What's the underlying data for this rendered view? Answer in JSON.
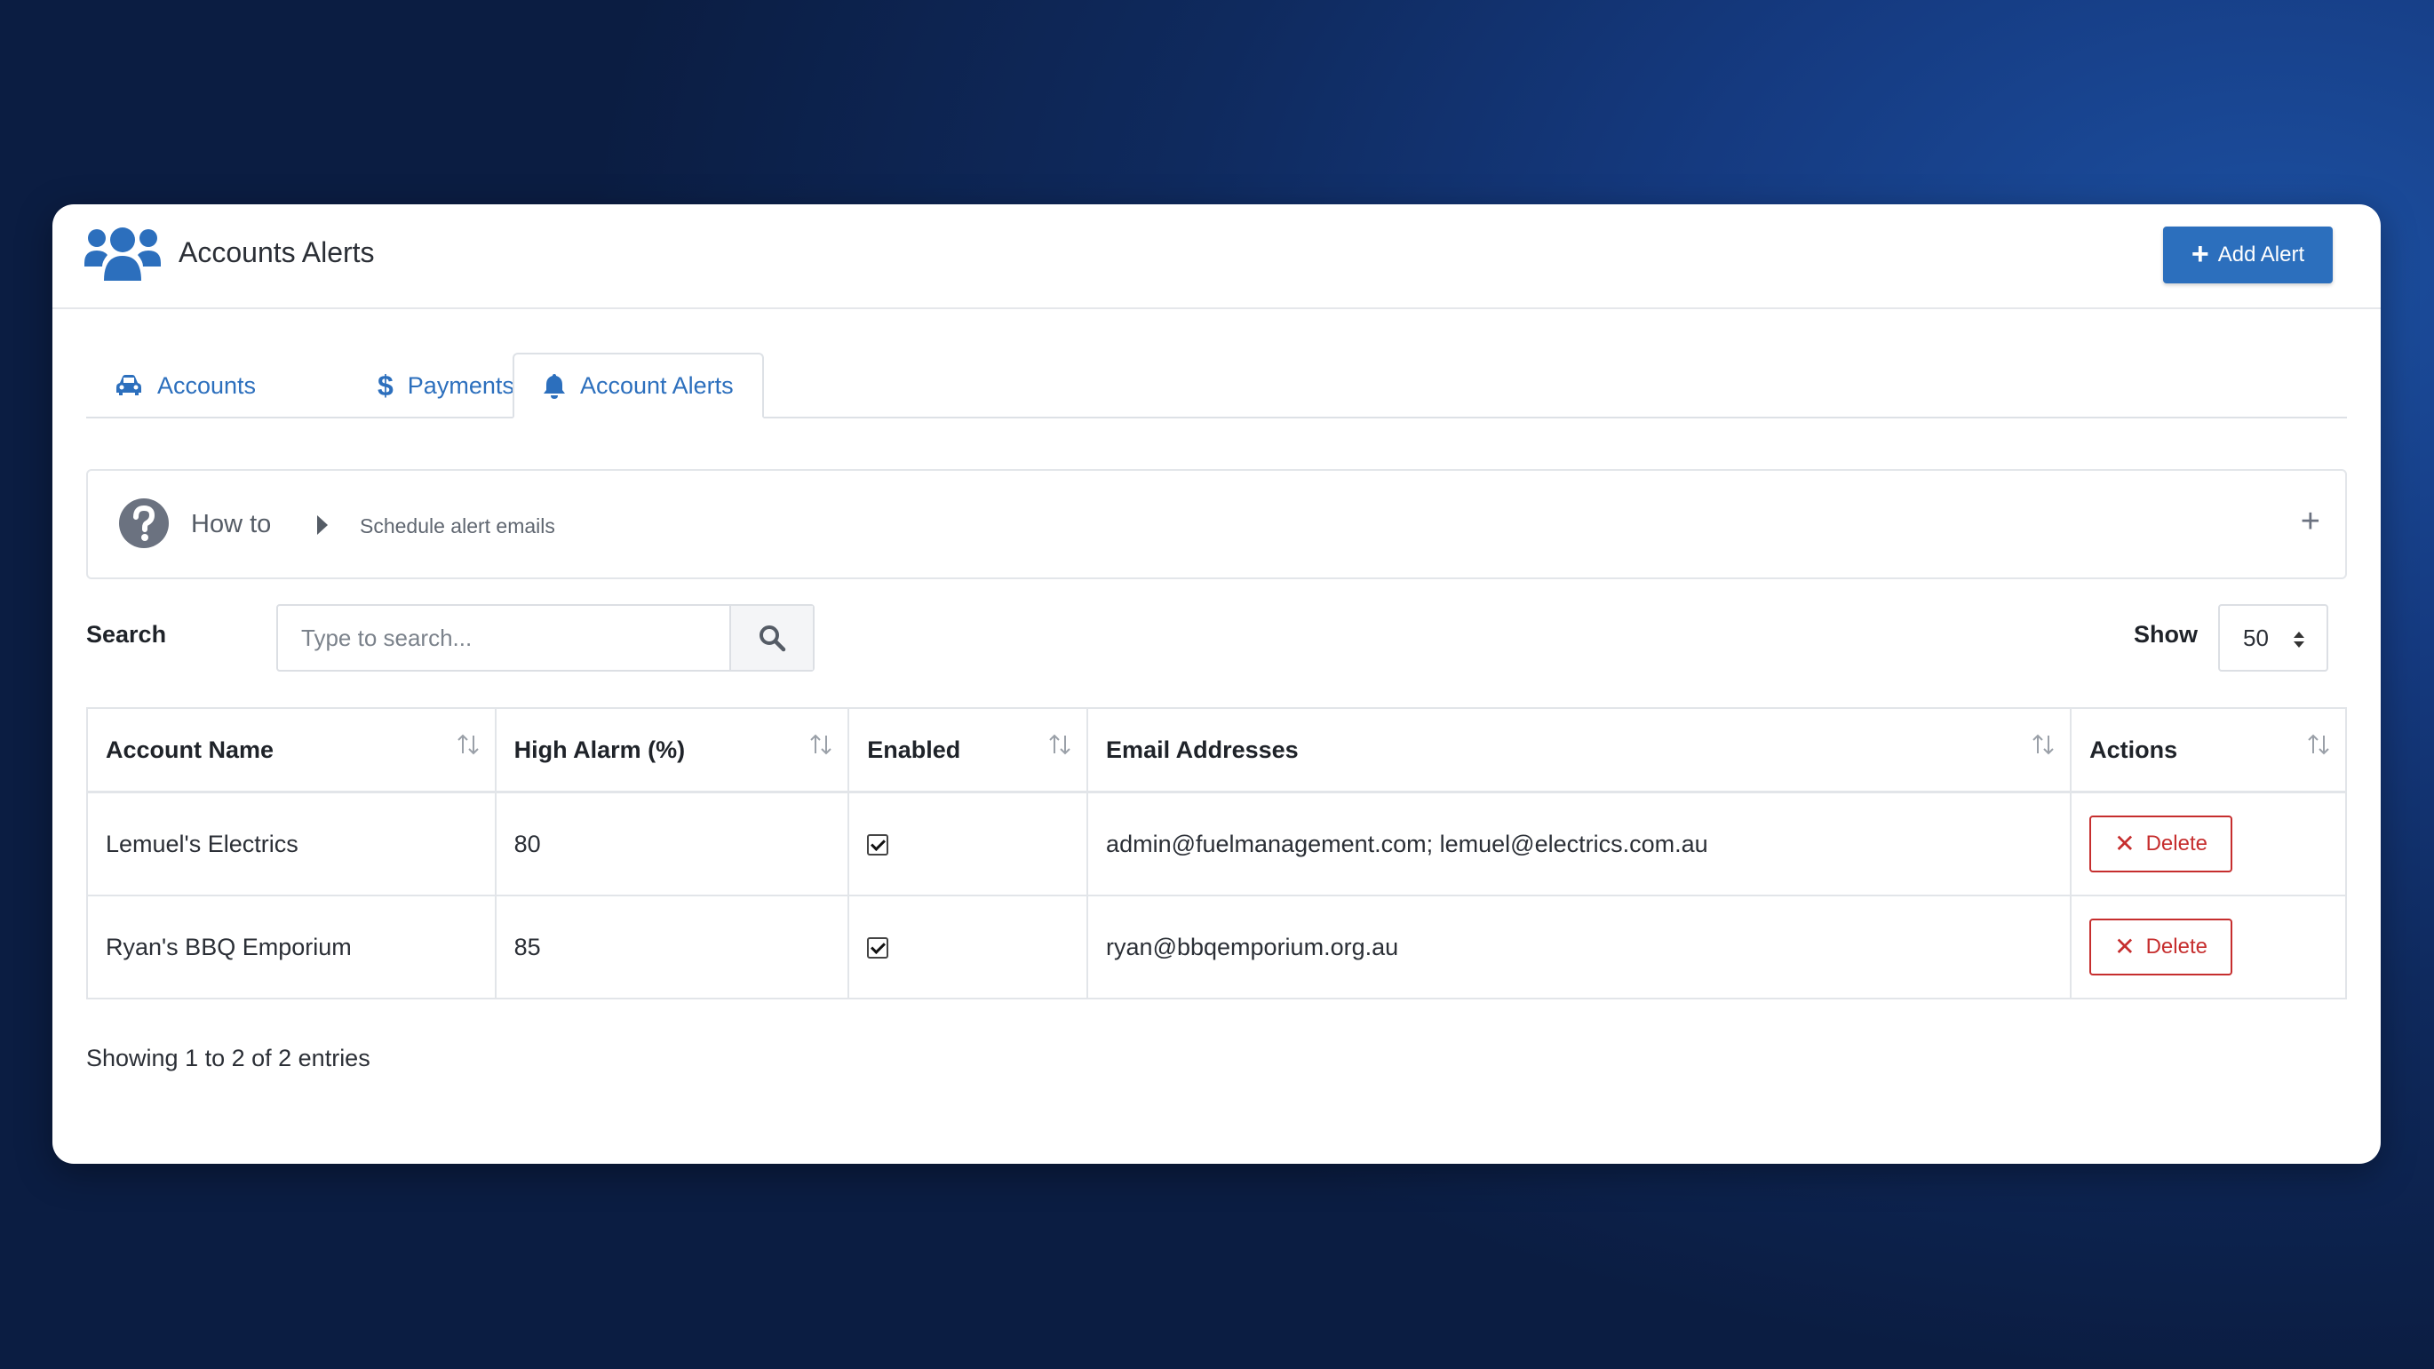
{
  "header": {
    "title": "Accounts Alerts",
    "add_label": "Add Alert",
    "accent": "#2c6fbd"
  },
  "tabs": [
    {
      "label": "Accounts",
      "icon": "car-icon"
    },
    {
      "label": "Payments",
      "icon": "dollar-icon"
    },
    {
      "label": "Account Alerts",
      "icon": "bell-icon",
      "active": true
    }
  ],
  "howto": {
    "label": "How to",
    "description": "Schedule alert emails",
    "expand_symbol": "+"
  },
  "search": {
    "label": "Search",
    "placeholder": "Type to search..."
  },
  "show": {
    "label": "Show",
    "value": "50"
  },
  "table": {
    "columns": [
      "Account Name",
      "High Alarm (%)",
      "Enabled",
      "Email Addresses",
      "Actions"
    ],
    "rows": [
      {
        "account": "Lemuel's Electrics",
        "high_alarm": "80",
        "enabled": true,
        "emails": "admin@fuelmanagement.com; lemuel@electrics.com.au",
        "action": "Delete"
      },
      {
        "account": "Ryan's BBQ Emporium",
        "high_alarm": "85",
        "enabled": true,
        "emails": "ryan@bbqemporium.org.au",
        "action": "Delete"
      }
    ]
  },
  "footer": {
    "info": "Showing 1 to 2 of 2 entries"
  }
}
